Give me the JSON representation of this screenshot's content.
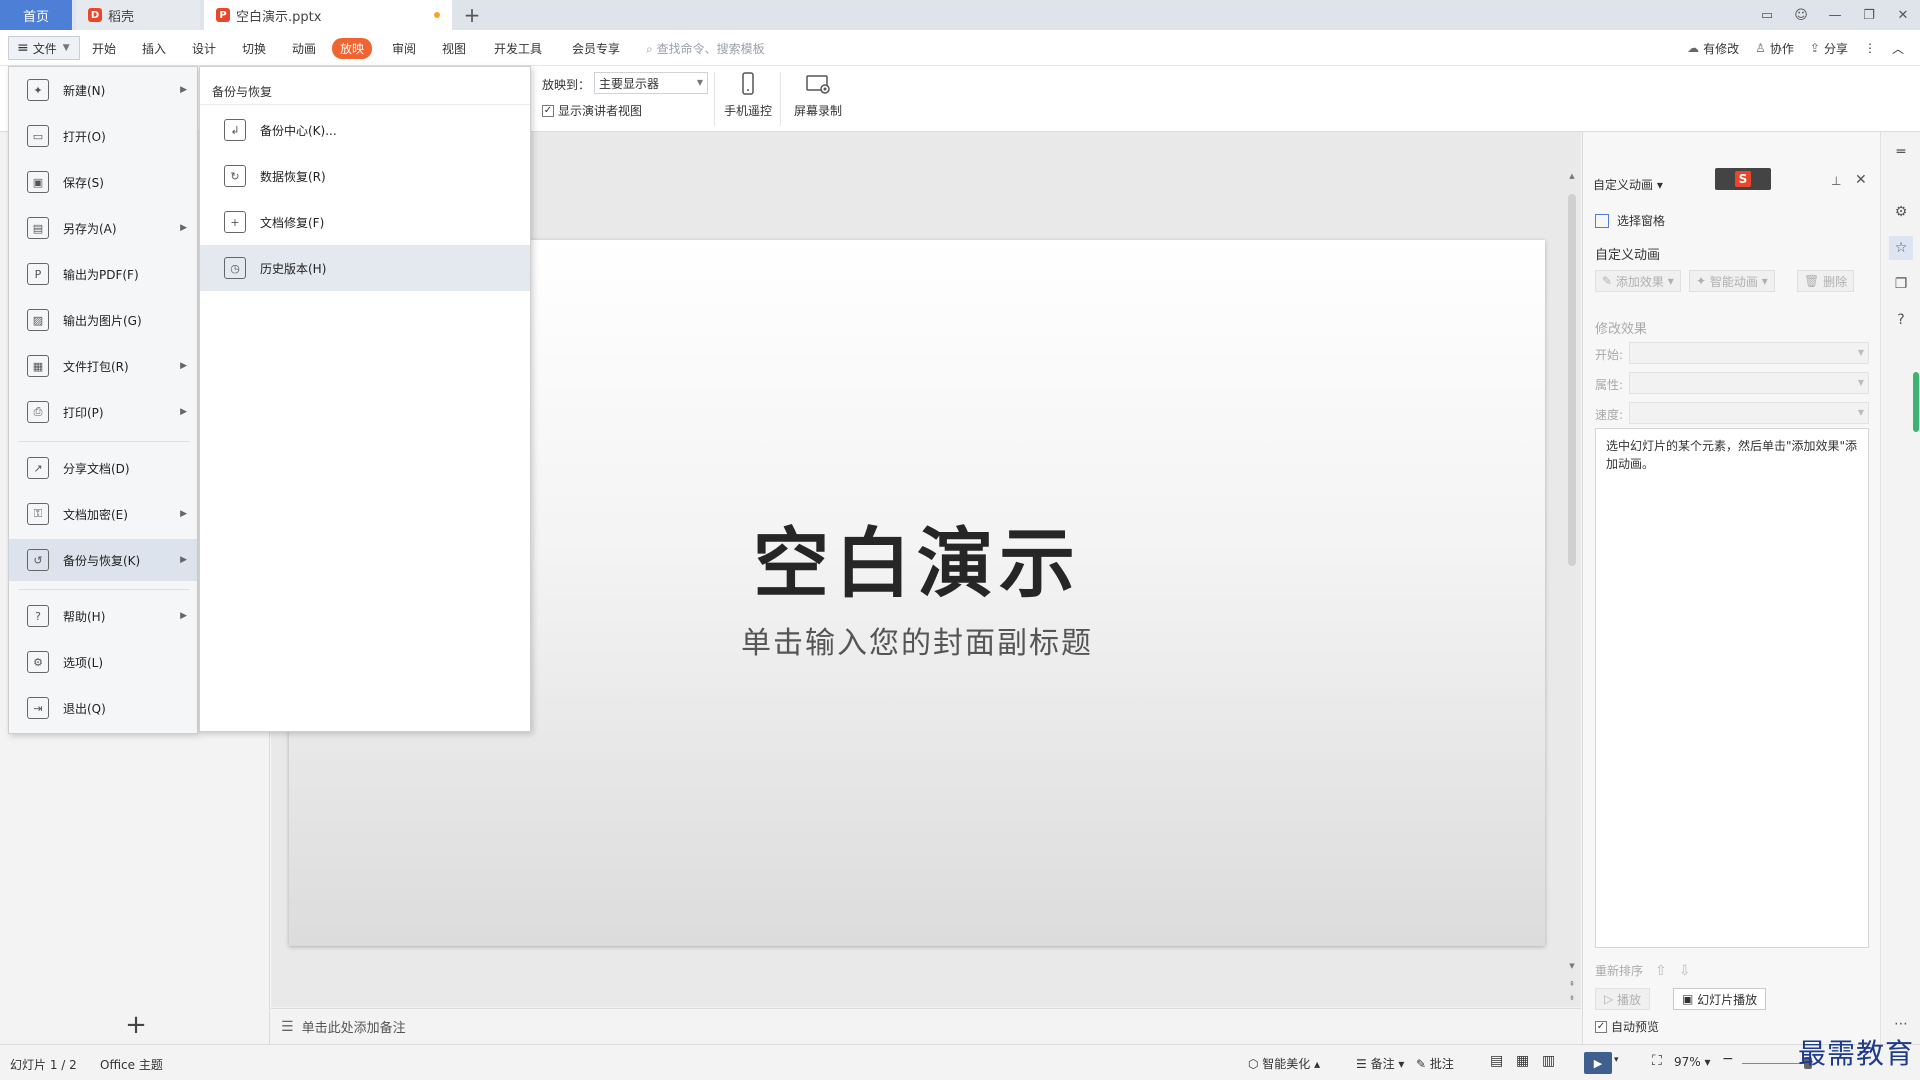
{
  "tabs": {
    "home": "首页",
    "daoke": "稻壳",
    "doc": "空白演示.pptx"
  },
  "menubar": {
    "file": "文件",
    "items": [
      "开始",
      "插入",
      "设计",
      "切换",
      "动画",
      "放映",
      "审阅",
      "视图",
      "开发工具",
      "会员专享"
    ],
    "search_placeholder": "查找命令、搜索模板",
    "right": [
      "有修改",
      "协作",
      "分享"
    ]
  },
  "ribbon": {
    "playto_label": "放映到：",
    "playto_value": "主要显示器",
    "presenter_view": "显示演讲者视图",
    "phone_remote": "手机遥控",
    "screen_record": "屏幕录制"
  },
  "file_menu": {
    "items": [
      {
        "label": "新建(N)",
        "icon": "new-icon",
        "has_sub": true
      },
      {
        "label": "打开(O)",
        "icon": "folder-open-icon",
        "has_sub": false
      },
      {
        "label": "保存(S)",
        "icon": "save-icon",
        "has_sub": false
      },
      {
        "label": "另存为(A)",
        "icon": "save-as-icon",
        "has_sub": true
      },
      {
        "label": "输出为PDF(F)",
        "icon": "pdf-icon",
        "has_sub": false
      },
      {
        "label": "输出为图片(G)",
        "icon": "image-icon",
        "has_sub": false
      },
      {
        "label": "文件打包(R)",
        "icon": "package-icon",
        "has_sub": true
      },
      {
        "label": "打印(P)",
        "icon": "print-icon",
        "has_sub": true
      },
      {
        "label": "分享文档(D)",
        "icon": "share-icon",
        "has_sub": false
      },
      {
        "label": "文档加密(E)",
        "icon": "lock-icon",
        "has_sub": true
      },
      {
        "label": "备份与恢复(K)",
        "icon": "backup-icon",
        "has_sub": true
      },
      {
        "label": "帮助(H)",
        "icon": "help-icon",
        "has_sub": true
      },
      {
        "label": "选项(L)",
        "icon": "gear-icon",
        "has_sub": false
      },
      {
        "label": "退出(Q)",
        "icon": "exit-icon",
        "has_sub": false
      }
    ]
  },
  "submenu": {
    "title": "备份与恢复",
    "items": [
      {
        "label": "备份中心(K)...",
        "icon": "backup-center-icon"
      },
      {
        "label": "数据恢复(R)",
        "icon": "data-recovery-icon"
      },
      {
        "label": "文档修复(F)",
        "icon": "doc-repair-icon"
      },
      {
        "label": "历史版本(H)",
        "icon": "history-icon"
      }
    ]
  },
  "slide": {
    "title": "空白演示",
    "subtitle": "单击输入您的封面副标题"
  },
  "notes_placeholder": "单击此处添加备注",
  "taskpane": {
    "header": "自定义动画",
    "select_pane": "选择窗格",
    "section_custom": "自定义动画",
    "add_effect": "添加效果",
    "smart_anim": "智能动画",
    "delete": "删除",
    "section_modify": "修改效果",
    "start_label": "开始:",
    "property_label": "属性:",
    "speed_label": "速度:",
    "hint": "选中幻灯片的某个元素，然后单击\"添加效果\"添加动画。",
    "reorder": "重新排序",
    "play": "播放",
    "slide_play": "幻灯片播放",
    "auto_preview": "自动预览"
  },
  "statusbar": {
    "slide_info": "幻灯片 1 / 2",
    "theme": "Office 主题",
    "beautify": "智能美化",
    "notes": "备注",
    "comments": "批注",
    "zoom": "97%"
  },
  "watermark": "最需教育",
  "colors": {
    "accent": "#4d7fd6",
    "slideshow_tab": "#f06432",
    "wps_red": "#e8472b"
  }
}
